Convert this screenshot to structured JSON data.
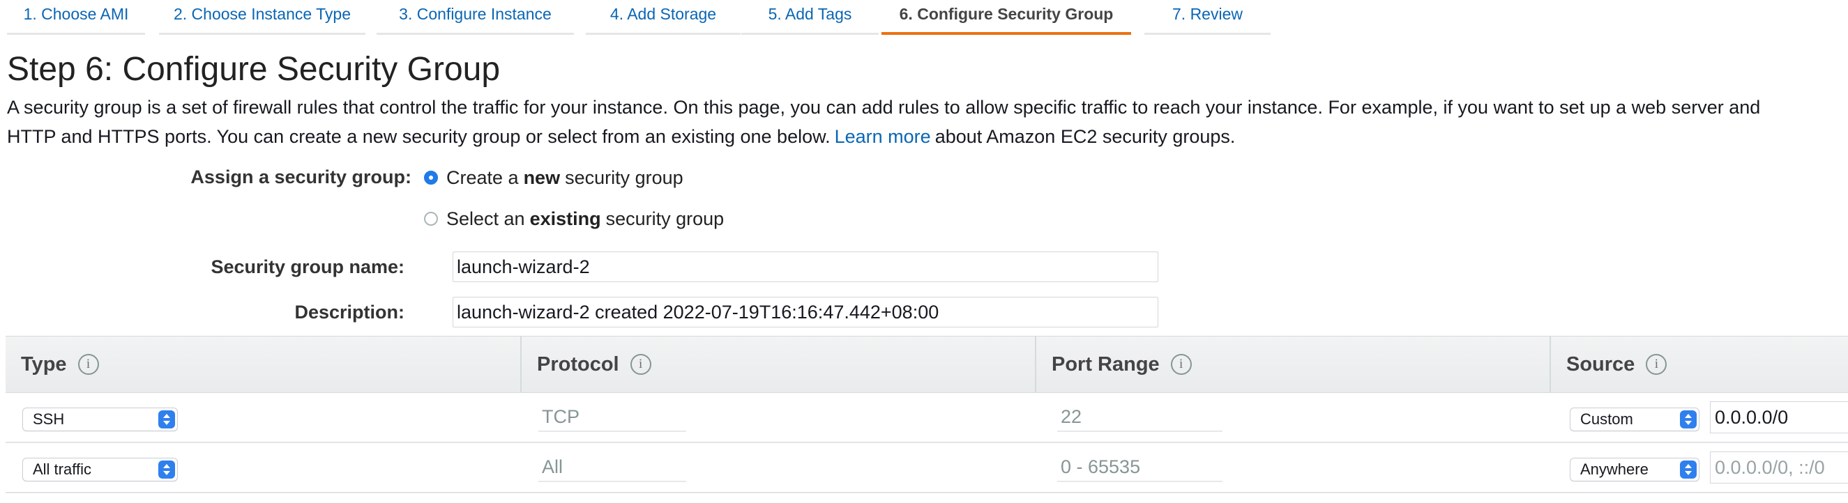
{
  "wizard": {
    "tabs": [
      {
        "label": "1. Choose AMI"
      },
      {
        "label": "2. Choose Instance Type"
      },
      {
        "label": "3. Configure Instance"
      },
      {
        "label": "4. Add Storage"
      },
      {
        "label": "5. Add Tags"
      },
      {
        "label": "6. Configure Security Group",
        "active": true
      },
      {
        "label": "7. Review"
      }
    ],
    "accent": "#ec7211",
    "link_color": "#0a66b4"
  },
  "page": {
    "title": "Step 6: Configure Security Group",
    "description_part1": "A security group is a set of firewall rules that control the traffic for your instance. On this page, you can add rules to allow specific traffic to reach your instance. For example, if you want to set up a web server and",
    "description_part2": "HTTP and HTTPS ports. You can create a new security group or select from an existing one below.",
    "learn_more": "Learn more",
    "description_part3": "about Amazon EC2 security groups."
  },
  "form": {
    "assign_label": "Assign a security group:",
    "option_new": {
      "prefix": "Create a",
      "bold": "new",
      "suffix": "security group",
      "selected": true
    },
    "option_existing": {
      "prefix": "Select an",
      "bold": "existing",
      "suffix": "security group",
      "selected": false
    },
    "name_label": "Security group name:",
    "name_value": "launch-wizard-2",
    "description_label": "Description:",
    "description_value": "launch-wizard-2 created 2022-07-19T16:16:47.442+08:00"
  },
  "table": {
    "columns": [
      {
        "label": "Type",
        "info_icon": "i"
      },
      {
        "label": "Protocol",
        "info_icon": "i"
      },
      {
        "label": "Port Range",
        "info_icon": "i"
      },
      {
        "label": "Source",
        "info_icon": "i"
      }
    ],
    "rows": [
      {
        "type": "SSH",
        "protocol": "TCP",
        "port_range": "22",
        "source_type": "Custom",
        "source_value": "0.0.0.0/0",
        "source_is_placeholder": false
      },
      {
        "type": "All traffic",
        "protocol": "All",
        "port_range": "0 - 65535",
        "source_type": "Anywhere",
        "source_value": "0.0.0.0/0, ::/0",
        "source_is_placeholder": true
      }
    ]
  }
}
